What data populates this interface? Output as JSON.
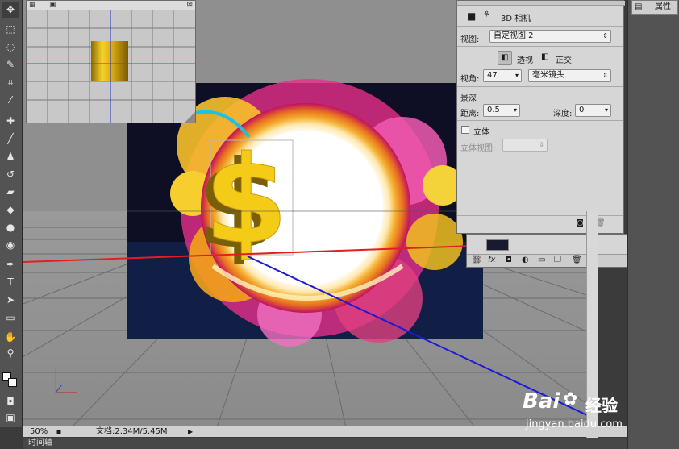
{
  "document": {
    "zoom": "50%",
    "doc_size": "文档:2.34M/5.45M",
    "timeline_tab": "时间轴"
  },
  "properties": {
    "panel_title": "3D 相机",
    "view_label": "视图:",
    "view_value": "自定视图 2",
    "perspective_label": "透视",
    "orthographic_label": "正交",
    "fov_label": "视角:",
    "fov_value": "47",
    "fov_unit": "毫米镜头",
    "dof_section": "景深",
    "distance_label": "距离:",
    "distance_value": "0.5",
    "depth_label": "深度:",
    "depth_value": "0",
    "stereo_label": "立体",
    "stereo_view_label": "立体视图:"
  },
  "dock": {
    "properties_button": "属性"
  },
  "watermark": {
    "brand_a": "Bai",
    "brand_b": "经验",
    "url": "jingyan.baidu.com"
  },
  "colors": {
    "ui_panel": "#d6d6d6",
    "toolbar": "#535353",
    "canvas_bg": "#8f8f8f",
    "x_axis": "#e02020",
    "z_axis": "#1a1ad8",
    "y_axis": "#2040c0",
    "dollar_gold": "#f2c80f"
  },
  "tool_icons": [
    "move-icon",
    "marquee-icon",
    "lasso-icon",
    "quick-select-icon",
    "crop-icon",
    "eyedropper-icon",
    "healing-brush-icon",
    "brush-icon",
    "stamp-icon",
    "history-brush-icon",
    "eraser-icon",
    "bucket-icon",
    "blur-icon",
    "dodge-icon",
    "pen-icon",
    "type-icon",
    "path-select-icon",
    "shape-icon",
    "hand-icon",
    "zoom-icon"
  ]
}
